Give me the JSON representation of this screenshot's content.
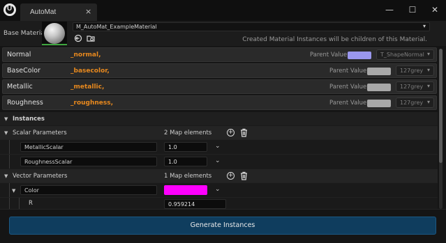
{
  "window": {
    "tab_title": "AutoMat",
    "tab_close": "×",
    "minimize": "—",
    "maximize": "☐",
    "close": "✕"
  },
  "header": {
    "base_material_label": "Base Material",
    "asset_name": "M_AutoMat_ExampleMaterial",
    "hint": "Created Material Instances will be children of this Material."
  },
  "params": [
    {
      "name": "Normal",
      "suffix": "_normal,",
      "parent_label": "Parent Value:",
      "swatch_color": "#9a97ee",
      "texture": "T_ShapeNormal"
    },
    {
      "name": "BaseColor",
      "suffix": "_basecolor,",
      "parent_label": "Parent Value:",
      "swatch_color": "#a8a8a8",
      "texture": "127grey"
    },
    {
      "name": "Metallic",
      "suffix": "_metallic,",
      "parent_label": "Parent Value:",
      "swatch_color": "#a8a8a8",
      "texture": "127grey"
    },
    {
      "name": "Roughness",
      "suffix": "_roughness,",
      "parent_label": "Parent Value:",
      "swatch_color": "#a8a8a8",
      "texture": "127grey"
    }
  ],
  "instances": {
    "section_title": "Instances",
    "scalar": {
      "title": "Scalar Parameters",
      "count": "2 Map elements",
      "rows": [
        {
          "key": "MetallicScalar",
          "value": "1.0"
        },
        {
          "key": "RoughnessScalar",
          "value": "1.0"
        }
      ]
    },
    "vector": {
      "title": "Vector Parameters",
      "count": "1 Map elements",
      "entry_key": "Color",
      "entry_color": "#ff00ff",
      "sub_label": "R",
      "sub_value": "0.959214"
    }
  },
  "footer": {
    "generate_label": "Generate Instances"
  }
}
